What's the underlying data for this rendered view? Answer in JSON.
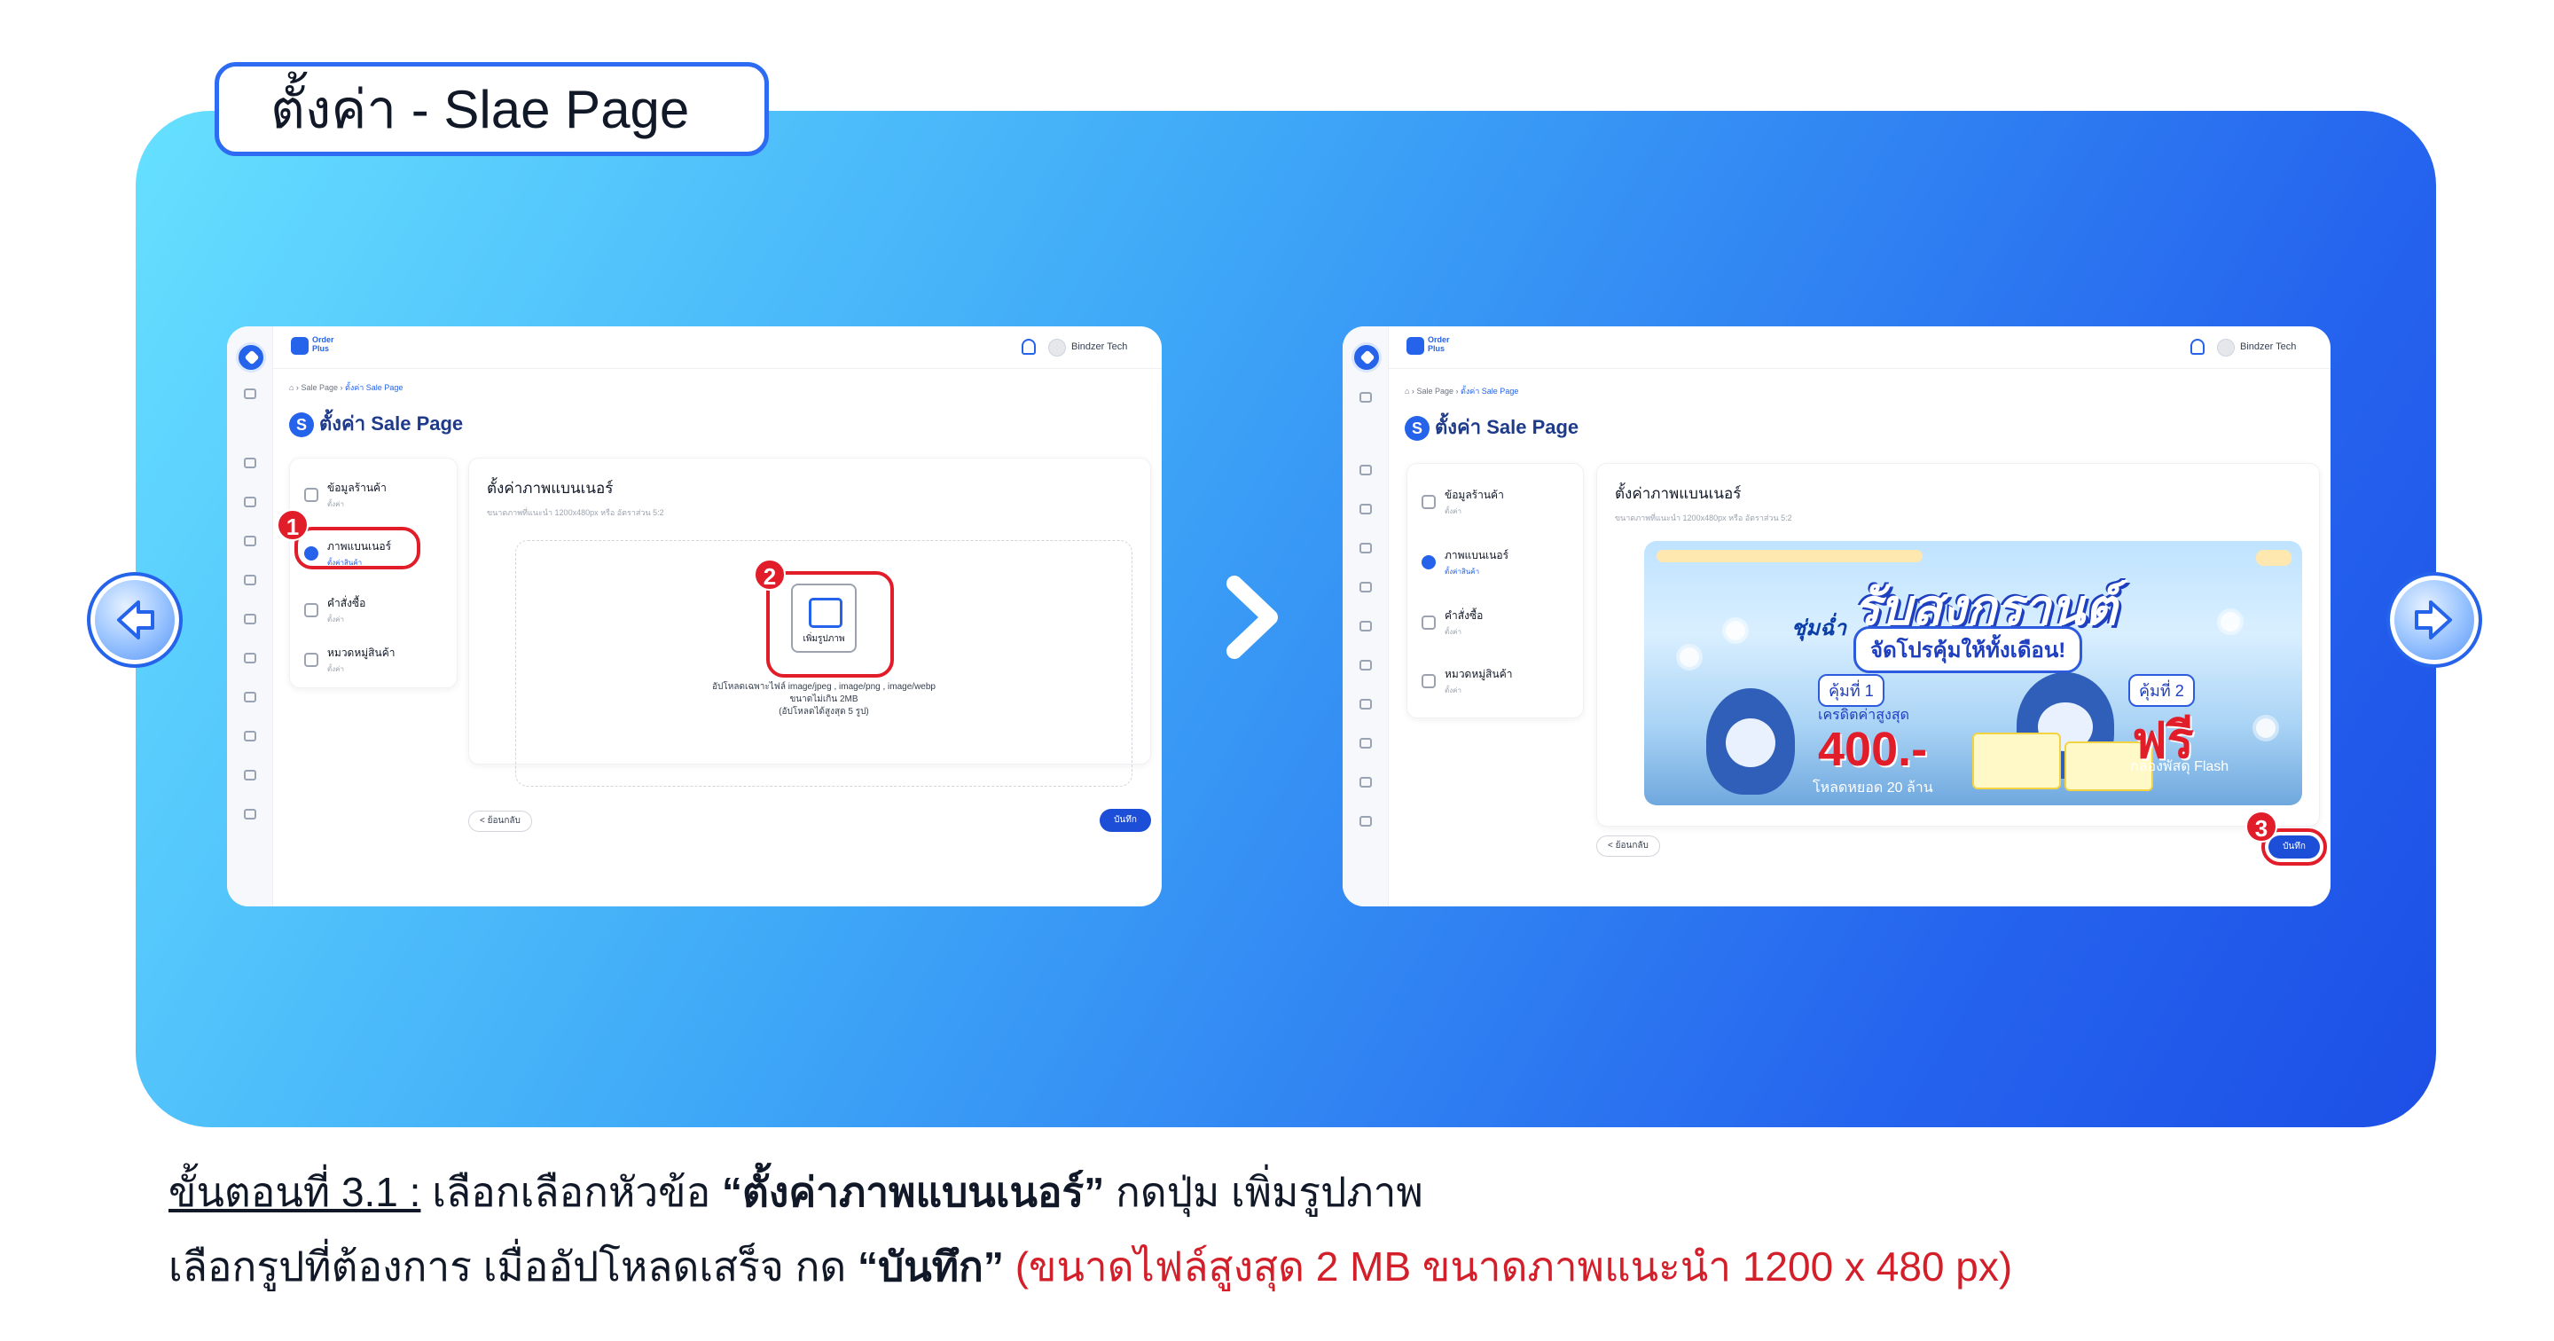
{
  "title_tab": "ตั้งค่า - Slae Page",
  "app": {
    "brand_line1": "Order",
    "brand_line2": "Plus",
    "user_name": "Bindzer Tech",
    "breadcrumb_root": "Sale Page",
    "breadcrumb_current": "ตั้งค่า Sale Page",
    "page_title": "ตั้งค่า Sale Page",
    "menu": [
      {
        "label": "ข้อมูลร้านค้า",
        "sub": "ตั้งค่า"
      },
      {
        "label": "ภาพแบนเนอร์",
        "sub": "ตั้งค่าสินค้า"
      },
      {
        "label": "คำสั่งซื้อ",
        "sub": "ตั้งค่า"
      },
      {
        "label": "หมวดหมู่สินค้า",
        "sub": "ตั้งค่า"
      }
    ],
    "section_title": "ตั้งค่าภาพแบนเนอร์",
    "section_hint": "ขนาดภาพที่แนะนำ 1200x480px หรือ อัตราส่วน 5:2",
    "upload_label": "เพิ่มรูปภาพ",
    "upload_info": [
      "อัปโหลดเฉพาะไฟล์ image/jpeg , image/png , image/webp",
      "ขนาดไม่เกิน 2MB",
      "(อัปโหลดได้สูงสุด 5 รูป)"
    ],
    "back_label": "< ย้อนกลับ",
    "save_label": "บันทึก"
  },
  "steps": [
    "1",
    "2",
    "3"
  ],
  "banner": {
    "pre": "ชุ่มฉ่ำ",
    "headline": "รับสงกรานต์",
    "subline": "จัดโปรคุ้มให้ทั้งเดือน!",
    "coupon1": "คุ้มที่ 1",
    "credit_label": "เครดิตค่าสูงสุด",
    "credit_value": "400.-",
    "credit_note": "โหลดหยอด 20 ล้าน",
    "coupon2": "คุ้มที่ 2",
    "free_label": "ฟรี",
    "free_note": "กล่องพัสดุ Flash"
  },
  "caption": {
    "step_label": "ขั้นตอนที่ 3.1 :",
    "line1_a": " เลือกเลือกหัวข้อ ",
    "line1_bold": "“ตั้งค่าภาพแบนเนอร์”",
    "line1_b": " กดปุ่ม เพิ่มรูปภาพ",
    "line2_a": "เลือกรูปที่ต้องการ เมื่ออัปโหลดเสร็จ กด ",
    "line2_bold": "“บันทึก”",
    "line2_red": " (ขนาดไฟล์สูงสุด 2 MB ขนาดภาพแนะนำ 1200 x 480 px)"
  },
  "colors": {
    "accent": "#2563eb",
    "highlight": "#e11d2a",
    "caption_red": "#d21f2a"
  }
}
